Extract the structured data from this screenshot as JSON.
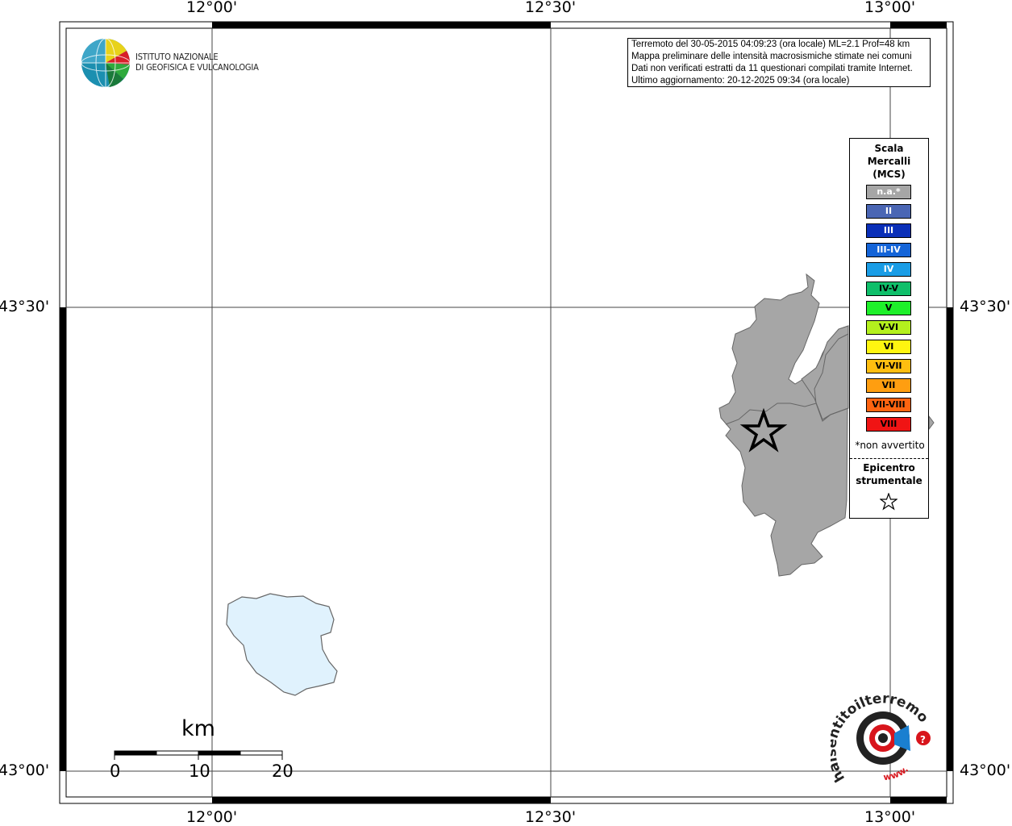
{
  "map": {
    "top_lon_labels": [
      "12°00'",
      "12°30'",
      "13°00'"
    ],
    "bottom_lon_labels": [
      "12°00'",
      "12°30'",
      "13°00'"
    ],
    "left_lat_labels": [
      "43°30'",
      "43°00'"
    ],
    "right_lat_labels": [
      "43°30'",
      "43°00'"
    ]
  },
  "logo": {
    "line1": "ISTITUTO NAZIONALE",
    "line2": "DI GEOFISICA E VULCANOLOGIA"
  },
  "info": {
    "line1": "Terremoto del 30-05-2015 04:09:23 (ora locale) ML=2.1 Prof=48 km",
    "line2": "Mappa preliminare delle intensità macrosismiche stimate nei comuni",
    "line3": "Dati non verificati estratti da 11 questionari compilati tramite Internet.",
    "line4": "Ultimo aggiornamento: 20-12-2025 09:34 (ora locale)"
  },
  "legend": {
    "title1": "Scala",
    "title2": "Mercalli",
    "title3": "(MCS)",
    "items": [
      {
        "label": "n.a.*",
        "color": "#a6a6a6",
        "text_color": "#ffffff"
      },
      {
        "label": "II",
        "color": "#4a66b4",
        "text_color": "#ffffff"
      },
      {
        "label": "III",
        "color": "#0a2fb8",
        "text_color": "#ffffff"
      },
      {
        "label": "III-IV",
        "color": "#1464d8",
        "text_color": "#ffffff"
      },
      {
        "label": "IV",
        "color": "#1a9de6",
        "text_color": "#ffffff"
      },
      {
        "label": "IV-V",
        "color": "#0fbf6a",
        "text_color": "#000000"
      },
      {
        "label": "V",
        "color": "#1ef02a",
        "text_color": "#000000"
      },
      {
        "label": "V-VI",
        "color": "#b4f01e",
        "text_color": "#000000"
      },
      {
        "label": "VI",
        "color": "#fff510",
        "text_color": "#000000"
      },
      {
        "label": "VI-VII",
        "color": "#ffbe10",
        "text_color": "#000000"
      },
      {
        "label": "VII",
        "color": "#ff9e10",
        "text_color": "#000000"
      },
      {
        "label": "VII-VIII",
        "color": "#ff6410",
        "text_color": "#000000"
      },
      {
        "label": "VIII",
        "color": "#f01414",
        "text_color": "#000000"
      }
    ],
    "note": "*non avvertito",
    "epicenter1": "Epicentro",
    "epicenter2": "strumentale"
  },
  "scale_bar": {
    "unit": "km",
    "labels": [
      "0",
      "10",
      "20"
    ]
  },
  "badge": {
    "arc_text": "haisentitoilterremoto.it",
    "url_text": "www.",
    "question": "?"
  }
}
